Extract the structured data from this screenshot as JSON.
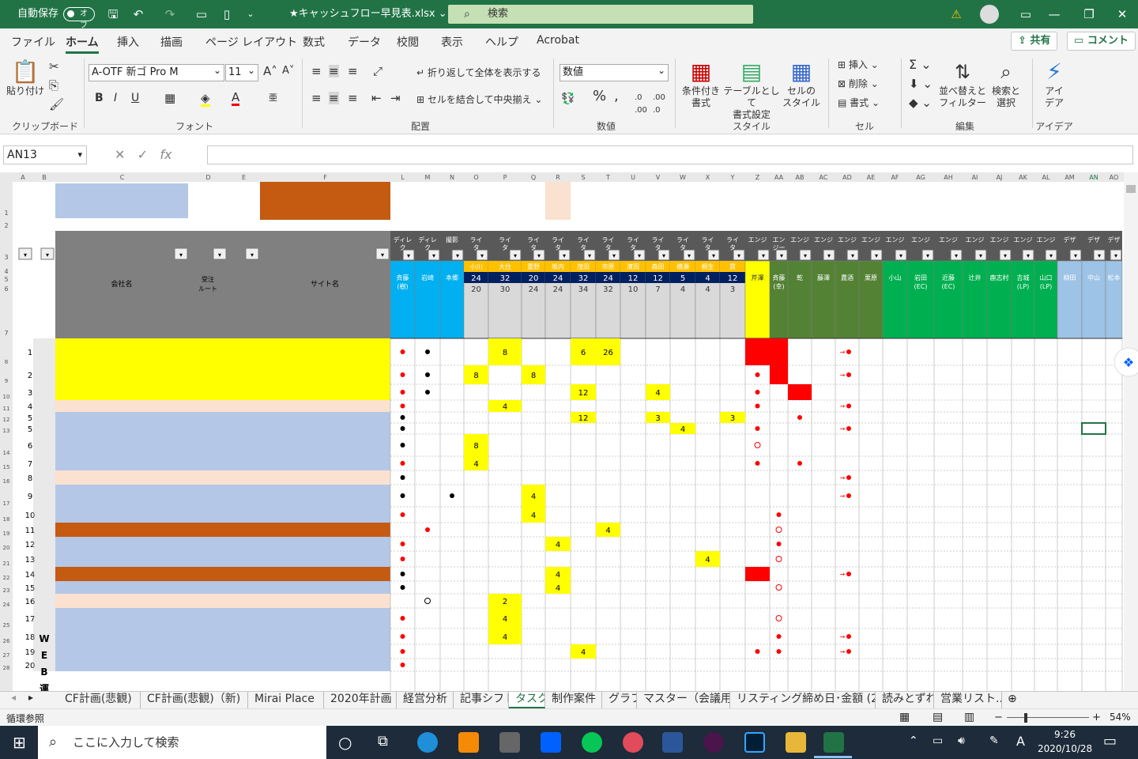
{
  "titlebar": {
    "autosave_label": "自動保存",
    "autosave_state": "オフ",
    "file_name": "★キャッシュフロー早見表.xlsx",
    "search_placeholder": "検索"
  },
  "menu": {
    "items": [
      "ファイル",
      "ホーム",
      "挿入",
      "描画",
      "ページ レイアウト",
      "数式",
      "データ",
      "校閲",
      "表示",
      "ヘルプ",
      "Acrobat"
    ],
    "share": "共有",
    "comment": "コメント"
  },
  "ribbon": {
    "clipboard": {
      "paste": "貼り付け",
      "label": "クリップボード"
    },
    "font": {
      "name": "A-OTF 新ゴ Pro M",
      "size": "11",
      "label": "フォント"
    },
    "alignment": {
      "wrap": "折り返して全体を表示する",
      "merge": "セルを結合して中央揃え",
      "label": "配置"
    },
    "number": {
      "format": "数値",
      "label": "数値"
    },
    "styles": {
      "conditional": "条件付き\n書式",
      "table": "テーブルとして\n書式設定",
      "cell": "セルの\nスタイル",
      "label": "スタイル"
    },
    "cells": {
      "insert": "挿入",
      "delete": "削除",
      "format": "書式",
      "label": "セル"
    },
    "editing": {
      "sort": "並べ替えと\nフィルター",
      "find": "検索と\n選択",
      "label": "編集"
    },
    "ideas": {
      "btn": "アイ\nデア",
      "label": "アイデア"
    }
  },
  "formula": {
    "namebox": "AN13",
    "value": ""
  },
  "grid": {
    "col_letters": [
      "A",
      "B",
      "C",
      "D",
      "E",
      "F",
      "L",
      "M",
      "N",
      "O",
      "P",
      "Q",
      "R",
      "S",
      "T",
      "U",
      "V",
      "W",
      "X",
      "Y",
      "Z",
      "AA",
      "AB",
      "AC",
      "AD",
      "AE",
      "AF",
      "AG",
      "AH",
      "AI",
      "AJ",
      "AK",
      "AL",
      "AM",
      "AN",
      "AO"
    ],
    "header_company": "会社名",
    "header_route": "受注\nルート",
    "header_site": "サイト名",
    "role_headers": [
      "ディレ\nク",
      "ディレ\nク",
      "撮影",
      "ライ\nタ",
      "ライ\nタ",
      "ライ\nタ",
      "ライ\nタ",
      "ライ\nタ",
      "ライ\nタ",
      "ライ\nタ",
      "ライ\nタ",
      "ライ\nタ",
      "ライ\nタ",
      "ライ\nタ",
      "エンジ",
      "エン\nジー",
      "エンジ",
      "エンジ",
      "エンジ",
      "エンジ",
      "エンジ",
      "エンジ",
      "エンジ",
      "エンジ",
      "エンジ",
      "エンジ",
      "エンジ",
      "デザ",
      "デザ",
      "デザ"
    ],
    "names": [
      "斉藤\n(樹)",
      "岩崎",
      "本郷",
      "小川",
      "大住",
      "重野",
      "坂内",
      "茂田",
      "市原",
      "濱田",
      "森田",
      "横瀬",
      "桐生",
      "貫",
      "芹澤",
      "斉藤\n(幸)",
      "乾",
      "藤澤",
      "農酒",
      "栗原",
      "小山",
      "岩田\n(EC)",
      "近藤\n(EC)",
      "辻井",
      "鹿志村",
      "吉城\n(LP)",
      "山口\n(LP)",
      "柳田",
      "中山",
      "松本"
    ],
    "capacity": [
      "",
      "",
      "",
      "24",
      "32",
      "20",
      "24",
      "32",
      "24",
      "12",
      "12",
      "5",
      "4",
      "12"
    ],
    "load": [
      "",
      "",
      "",
      "20",
      "30",
      "24",
      "24",
      "34",
      "32",
      "10",
      "7",
      "4",
      "4",
      "3"
    ],
    "row_numbers": [
      "1",
      "2",
      "3",
      "4",
      "5",
      "5",
      "6",
      "7",
      "8",
      "9",
      "10",
      "11",
      "12",
      "13",
      "14",
      "15",
      "16",
      "17",
      "18",
      "19",
      "20"
    ],
    "excel_rows": [
      "8",
      "9",
      "10",
      "11",
      "12",
      "13",
      "14",
      "15",
      "16",
      "17",
      "18",
      "19",
      "20",
      "21",
      "22",
      "23",
      "24",
      "25",
      "26",
      "27",
      "28"
    ],
    "side_label": "WEB運",
    "filled": [
      [
        4,
        1,
        "8"
      ],
      [
        7,
        1,
        "6"
      ],
      [
        8,
        1,
        "26"
      ],
      [
        3,
        2,
        "8"
      ],
      [
        5,
        2,
        "8"
      ],
      [
        7,
        3,
        "12"
      ],
      [
        10,
        3,
        "4"
      ],
      [
        4,
        4,
        "4"
      ],
      [
        7,
        5,
        "12"
      ],
      [
        10,
        5,
        "3"
      ],
      [
        13,
        5,
        "3"
      ],
      [
        11,
        6,
        "4"
      ],
      [
        3,
        7,
        "8"
      ],
      [
        3,
        8,
        "4"
      ],
      [
        5,
        10,
        "4"
      ],
      [
        5,
        11,
        "4"
      ],
      [
        8,
        12,
        "4"
      ],
      [
        6,
        13,
        "4"
      ],
      [
        12,
        14,
        "4"
      ],
      [
        6,
        15,
        "4"
      ],
      [
        6,
        16,
        "4"
      ],
      [
        4,
        17,
        "2"
      ],
      [
        4,
        18,
        "4"
      ],
      [
        4,
        19,
        "4"
      ],
      [
        7,
        20,
        "4"
      ]
    ]
  },
  "sheets": [
    "CF計画(悲観)",
    "CF計画(悲観)（新)",
    "Mirai Place",
    "2020年計画",
    "経営分析",
    "記事シフト",
    "タスク",
    "制作案件",
    "グラフ",
    "マスター（会議用)",
    "リスティング締め日･金額 (2)",
    "読みとずれ",
    "営業リスト..."
  ],
  "active_sheet": "タスク",
  "status": {
    "left": "循環参照",
    "zoom": "54%"
  },
  "taskbar": {
    "search": "ここに入力して検索",
    "time": "9:26",
    "date": "2020/10/28",
    "ime": "A"
  }
}
